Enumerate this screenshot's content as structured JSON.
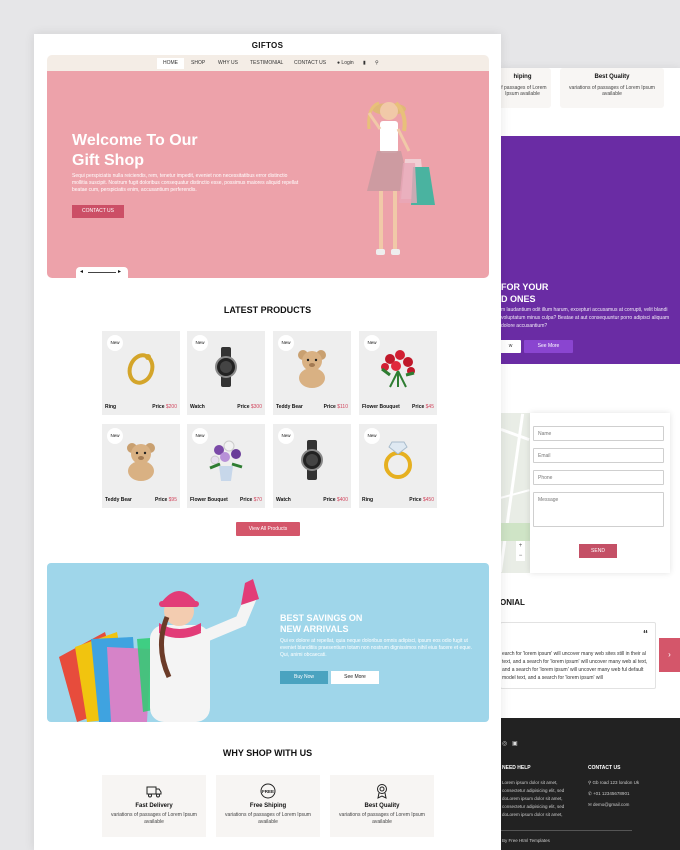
{
  "brand": "GIFTOS",
  "nav": {
    "items": [
      "HOME",
      "SHOP",
      "WHY US",
      "TESTIMONIAL",
      "CONTACT US"
    ],
    "login": "Login"
  },
  "hero": {
    "title_line1": "Welcome To Our",
    "title_line2": "Gift Shop",
    "text": "Sequi perspiciatis nulla reiciendis, rem, tenetur impedit, eveniet non necessitatibus error distinctio mollitia suscipit. Nostrum fugit doloribus consequatur distinctio esse, possimus maiores aliquid repellat beatae cum, perspiciatis enim, accusantium perferendis.",
    "button": "CONTACT US"
  },
  "products": {
    "heading": "LATEST PRODUCTS",
    "badge": "New",
    "price_label": "Price",
    "items": [
      {
        "name": "Ring",
        "price": "$200",
        "icon": "ring"
      },
      {
        "name": "Watch",
        "price": "$300",
        "icon": "watch"
      },
      {
        "name": "Teddy Bear",
        "price": "$110",
        "icon": "teddy-bear"
      },
      {
        "name": "Flower Bouquet",
        "price": "$45",
        "icon": "roses"
      },
      {
        "name": "Teddy Bear",
        "price": "$95",
        "icon": "teddy-bear"
      },
      {
        "name": "Flower Bouquet",
        "price": "$70",
        "icon": "flower-vase"
      },
      {
        "name": "Watch",
        "price": "$400",
        "icon": "watch"
      },
      {
        "name": "Ring",
        "price": "$450",
        "icon": "diamond-ring"
      }
    ],
    "view_all": "View All Products"
  },
  "savings": {
    "title_line1": "BEST SAVINGS ON",
    "title_line2": "NEW ARRIVALS",
    "text": "Qui ex dolore at repellat, quia neque doloribus omnis adipisci, ipsum eos odio fugit ut eveniet blanditiis praesentium totam non nostrum dignissimos nihil eius facere et eque. Qui, animi obcaecati.",
    "buy": "Buy Now",
    "see_more": "See More"
  },
  "why": {
    "heading": "WHY SHOP WITH US",
    "cards": [
      {
        "title": "Fast Delivery",
        "text": "variations of passages of Lorem Ipsum available",
        "icon": "truck"
      },
      {
        "title": "Free Shiping",
        "text": "variations of passages of Lorem Ipsum available",
        "icon": "free-badge"
      },
      {
        "title": "Best Quality",
        "text": "variations of passages of Lorem Ipsum available",
        "icon": "medal"
      }
    ],
    "free_badge": "FREE"
  },
  "back": {
    "card1_title": "hiping",
    "card1_text": "of passages of Lorem Ipsum available",
    "card2_title": "Best Quality",
    "card2_text": "variations of passages of Lorem Ipsum available",
    "promo_title_line1": "FOR YOUR",
    "promo_title_line2": "D ONES",
    "promo_text": "m laudantium odit illum harum, excepturi accusamus at corrupti, velit blandi voluptatum minus culpa? Beatae at aut consequuntur porro adipisci aliquam dolore accusantium?",
    "promo_btn1": "w",
    "promo_btn2": "See More",
    "form": {
      "name": "Name",
      "email": "Email",
      "phone": "Phone",
      "message": "Message",
      "send": "SEND"
    },
    "testimonial_heading": "ONIAL",
    "testimonial_text": "earch for 'lorem ipsum' will uncover many web sites still in their al text, and a search for 'lorem ipsum' will uncover many web al text, and a search for 'lorem ipsum' will uncover many web ful default model text, and a search for 'lorem ipsum' will",
    "quote": "“",
    "footer": {
      "need_help": "NEED HELP",
      "need_help_text": "Lorem ipsum dolor sit amet, consectetur adipisicing elit, sed doLorem ipsum dolor sit amet, consectetur adipisicing elit, sed doLorem ipsum dolor sit amet,",
      "contact_us": "CONTACT US",
      "address": "Gb road 123 london Uk",
      "phone": "+01 12345678901",
      "email": "demo@gmail.com",
      "credit": "By Free Html Templates"
    }
  }
}
